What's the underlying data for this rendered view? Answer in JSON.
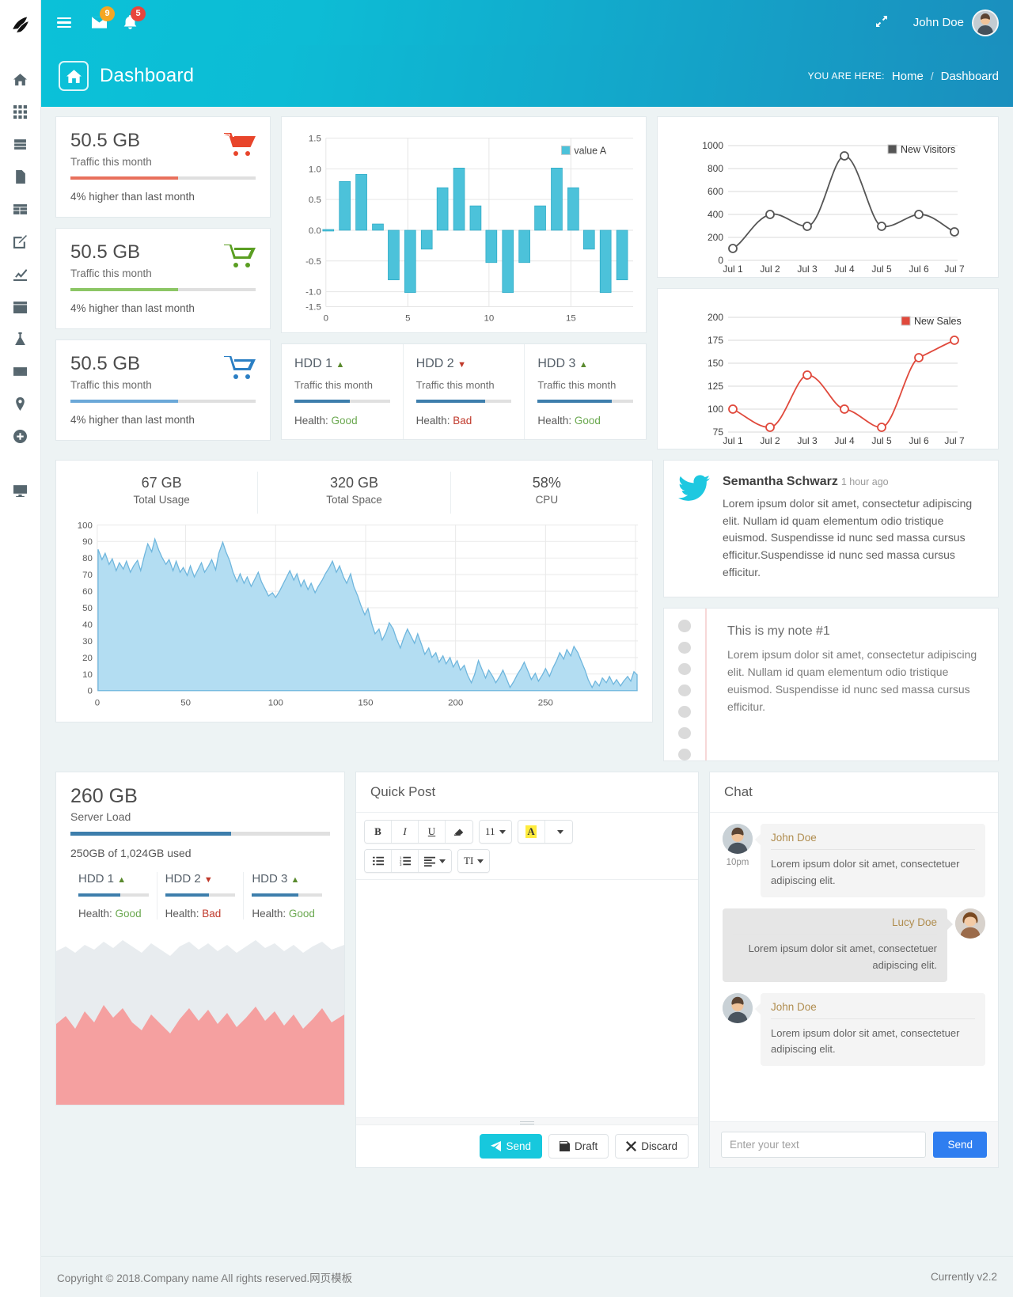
{
  "header": {
    "mail_badge": "9",
    "notif_badge": "5",
    "user_name": "John Doe",
    "menu_icon": "hamburger-icon",
    "mail_icon": "envelope-icon",
    "bell_icon": "bell-icon",
    "expand_icon": "fullscreen-icon"
  },
  "ribbon": {
    "title": "Dashboard",
    "home_icon": "home-icon",
    "breadcrumb_label": "YOU ARE HERE:",
    "crumb_home": "Home",
    "crumb_sep": "/",
    "crumb_current": "Dashboard"
  },
  "sidebar": {
    "items": [
      {
        "name": "sidebar-item-home",
        "icon": "home-icon"
      },
      {
        "name": "sidebar-item-grid",
        "icon": "grid-icon"
      },
      {
        "name": "sidebar-item-drawer",
        "icon": "drawer-icon"
      },
      {
        "name": "sidebar-item-file",
        "icon": "file-icon"
      },
      {
        "name": "sidebar-item-table",
        "icon": "table-icon"
      },
      {
        "name": "sidebar-item-edit",
        "icon": "pencil-square-icon"
      },
      {
        "name": "sidebar-item-analytics",
        "icon": "line-chart-icon"
      },
      {
        "name": "sidebar-item-calendar",
        "icon": "calendar-icon"
      },
      {
        "name": "sidebar-item-lab",
        "icon": "flask-icon"
      },
      {
        "name": "sidebar-item-mail",
        "icon": "envelope-icon"
      },
      {
        "name": "sidebar-item-map",
        "icon": "map-marker-icon"
      },
      {
        "name": "sidebar-item-add",
        "icon": "plus-circle-icon"
      },
      {
        "name": "sidebar-item-monitor",
        "icon": "desktop-icon"
      }
    ]
  },
  "traffic_cards": [
    {
      "value": "50.5 GB",
      "label": "Traffic this month",
      "note": "4% higher than last month",
      "color": "#e8452b",
      "bar_color": "#e8705c",
      "percent": 58,
      "icon": "shopping-cart-icon"
    },
    {
      "value": "50.5 GB",
      "label": "Traffic this month",
      "note": "4% higher than last month",
      "color": "#5a9e22",
      "bar_color": "#8cc665",
      "percent": 58,
      "icon": "shopping-cart-icon"
    },
    {
      "value": "50.5 GB",
      "label": "Traffic this month",
      "note": "4% higher than last month",
      "color": "#2b7fc4",
      "bar_color": "#6ba8d8",
      "percent": 58,
      "icon": "shopping-cart-icon"
    }
  ],
  "hdd_cards": [
    {
      "title": "HDD 1",
      "trend": "up",
      "sub": "Traffic this month",
      "percent": 58,
      "health_label": "Health:",
      "health": "Good",
      "health_state": "good"
    },
    {
      "title": "HDD 2",
      "trend": "down",
      "sub": "Traffic this month",
      "percent": 72,
      "health_label": "Health:",
      "health": "Bad",
      "health_state": "bad"
    },
    {
      "title": "HDD 3",
      "trend": "up",
      "sub": "Traffic this month",
      "percent": 78,
      "health_label": "Health:",
      "health": "Good",
      "health_state": "good"
    }
  ],
  "usage": {
    "stats": [
      {
        "value": "67 GB",
        "label": "Total Usage"
      },
      {
        "value": "320 GB",
        "label": "Total Space"
      },
      {
        "value": "58%",
        "label": "CPU"
      }
    ]
  },
  "twitter": {
    "icon": "twitter-bird-icon",
    "name": "Semantha Schwarz",
    "time": "1 hour ago",
    "text": "Lorem ipsum dolor sit amet, consectetur adipiscing elit. Nullam id quam elementum odio tristique euismod. Suspendisse id nunc sed massa cursus efficitur.Suspendisse id nunc sed massa cursus efficitur."
  },
  "note": {
    "title": "This is my note #1",
    "text": "Lorem ipsum dolor sit amet, consectetur adipiscing elit. Nullam id quam elementum odio tristique euismod. Suspendisse id nunc sed massa cursus efficitur."
  },
  "server": {
    "value": "260 GB",
    "label": "Server Load",
    "percent": 62,
    "used": "250GB of 1,024GB used",
    "hdds": [
      {
        "title": "HDD 1",
        "trend": "up",
        "percent": 60,
        "health_label": "Health:",
        "health": "Good",
        "health_state": "good"
      },
      {
        "title": "HDD 2",
        "trend": "down",
        "percent": 62,
        "health_label": "Health:",
        "health": "Bad",
        "health_state": "bad"
      },
      {
        "title": "HDD 3",
        "trend": "up",
        "percent": 66,
        "health_label": "Health:",
        "health": "Good",
        "health_state": "good"
      }
    ]
  },
  "quick_post": {
    "title": "Quick Post",
    "toolbar_row1": [
      {
        "label": "B",
        "name": "bold-button"
      },
      {
        "label": "I",
        "name": "italic-button"
      },
      {
        "label": "U",
        "name": "underline-button"
      },
      {
        "label": "",
        "name": "eraser-icon"
      }
    ],
    "font_size": "11",
    "highlight_letter": "A",
    "toolbar_row2": [
      {
        "label": "",
        "name": "unordered-list-icon"
      },
      {
        "label": "",
        "name": "ordered-list-icon"
      },
      {
        "label": "",
        "name": "align-left-icon"
      },
      {
        "label": "TI",
        "name": "text-style-icon"
      }
    ],
    "send": "Send",
    "draft": "Draft",
    "discard": "Discard"
  },
  "chat": {
    "title": "Chat",
    "messages": [
      {
        "side": "left",
        "who": "John Doe",
        "time": "10pm",
        "text": "Lorem ipsum dolor sit amet, consectetuer adipiscing elit."
      },
      {
        "side": "right",
        "who": "Lucy Doe",
        "time": "",
        "text": "Lorem ipsum dolor sit amet, consectetuer adipiscing elit."
      },
      {
        "side": "left",
        "who": "John Doe",
        "time": "",
        "text": "Lorem ipsum dolor sit amet, consectetuer adipiscing elit."
      }
    ],
    "input_placeholder": "Enter your text",
    "send_label": "Send"
  },
  "footer": {
    "copyright": "Copyright © 2018.Company name All rights reserved.网页模板",
    "version": "Currently v2.2"
  },
  "chart_data": [
    {
      "type": "bar",
      "title": "",
      "legend": [
        "value A"
      ],
      "legend_position": "top-right",
      "color": "#49c0d8",
      "xlabel": "",
      "ylabel": "",
      "xlim": [
        0,
        19
      ],
      "ylim": [
        -1.5,
        1.5
      ],
      "xticks": [
        0,
        5,
        10,
        15
      ],
      "yticks": [
        -1.5,
        -1.0,
        -0.5,
        0.0,
        0.5,
        1.0,
        1.5
      ],
      "x": [
        0,
        1,
        2,
        3,
        4,
        5,
        6,
        7,
        8,
        9,
        10,
        11,
        12,
        13,
        14,
        15,
        16,
        17,
        18
      ],
      "values": [
        0.01,
        0.8,
        0.91,
        0.1,
        -0.81,
        -1.01,
        -0.31,
        0.7,
        1.01,
        0.4,
        -0.52,
        -1.01,
        -0.52,
        0.4,
        1.01,
        0.7,
        -0.3,
        -1.01,
        -0.81
      ],
      "grid": true
    },
    {
      "type": "line",
      "title": "",
      "legend": [
        "New Visitors"
      ],
      "legend_position": "top-right",
      "color": "#555555",
      "categories": [
        "Jul 1",
        "Jul 2",
        "Jul 3",
        "Jul 4",
        "Jul 5",
        "Jul 6",
        "Jul 7"
      ],
      "values": [
        100,
        500,
        300,
        900,
        300,
        500,
        350
      ],
      "ylim": [
        0,
        1000
      ],
      "yticks": [
        0,
        200,
        400,
        600,
        800,
        1000
      ],
      "markers": true,
      "grid": true
    },
    {
      "type": "line",
      "title": "",
      "legend": [
        "New Sales"
      ],
      "legend_position": "top-right",
      "color": "#e0493c",
      "categories": [
        "Jul 1",
        "Jul 2",
        "Jul 3",
        "Jul 4",
        "Jul 5",
        "Jul 6",
        "Jul 7"
      ],
      "values": [
        100,
        80,
        140,
        100,
        80,
        160,
        180
      ],
      "ylim": [
        75,
        200
      ],
      "yticks": [
        75,
        100,
        125,
        150,
        175,
        200
      ],
      "markers": true,
      "grid": true
    },
    {
      "type": "area",
      "title": "",
      "legend": [],
      "color": "#8fd4ee",
      "xlabel": "",
      "ylabel": "",
      "xlim": [
        0,
        290
      ],
      "ylim": [
        0,
        100
      ],
      "xticks": [
        0,
        50,
        100,
        150,
        200,
        250
      ],
      "yticks": [
        0,
        10,
        20,
        30,
        40,
        50,
        60,
        70,
        80,
        90,
        100
      ],
      "description": "CPU usage time series declining from ~85 to ~15",
      "grid": true
    },
    {
      "type": "area",
      "title": "",
      "legend": [],
      "series": [
        {
          "name": "background",
          "color": "#e8ecef"
        },
        {
          "name": "load",
          "color": "#f5a0a0"
        }
      ],
      "description": "Server load stacked area sparkline",
      "grid": false
    }
  ]
}
